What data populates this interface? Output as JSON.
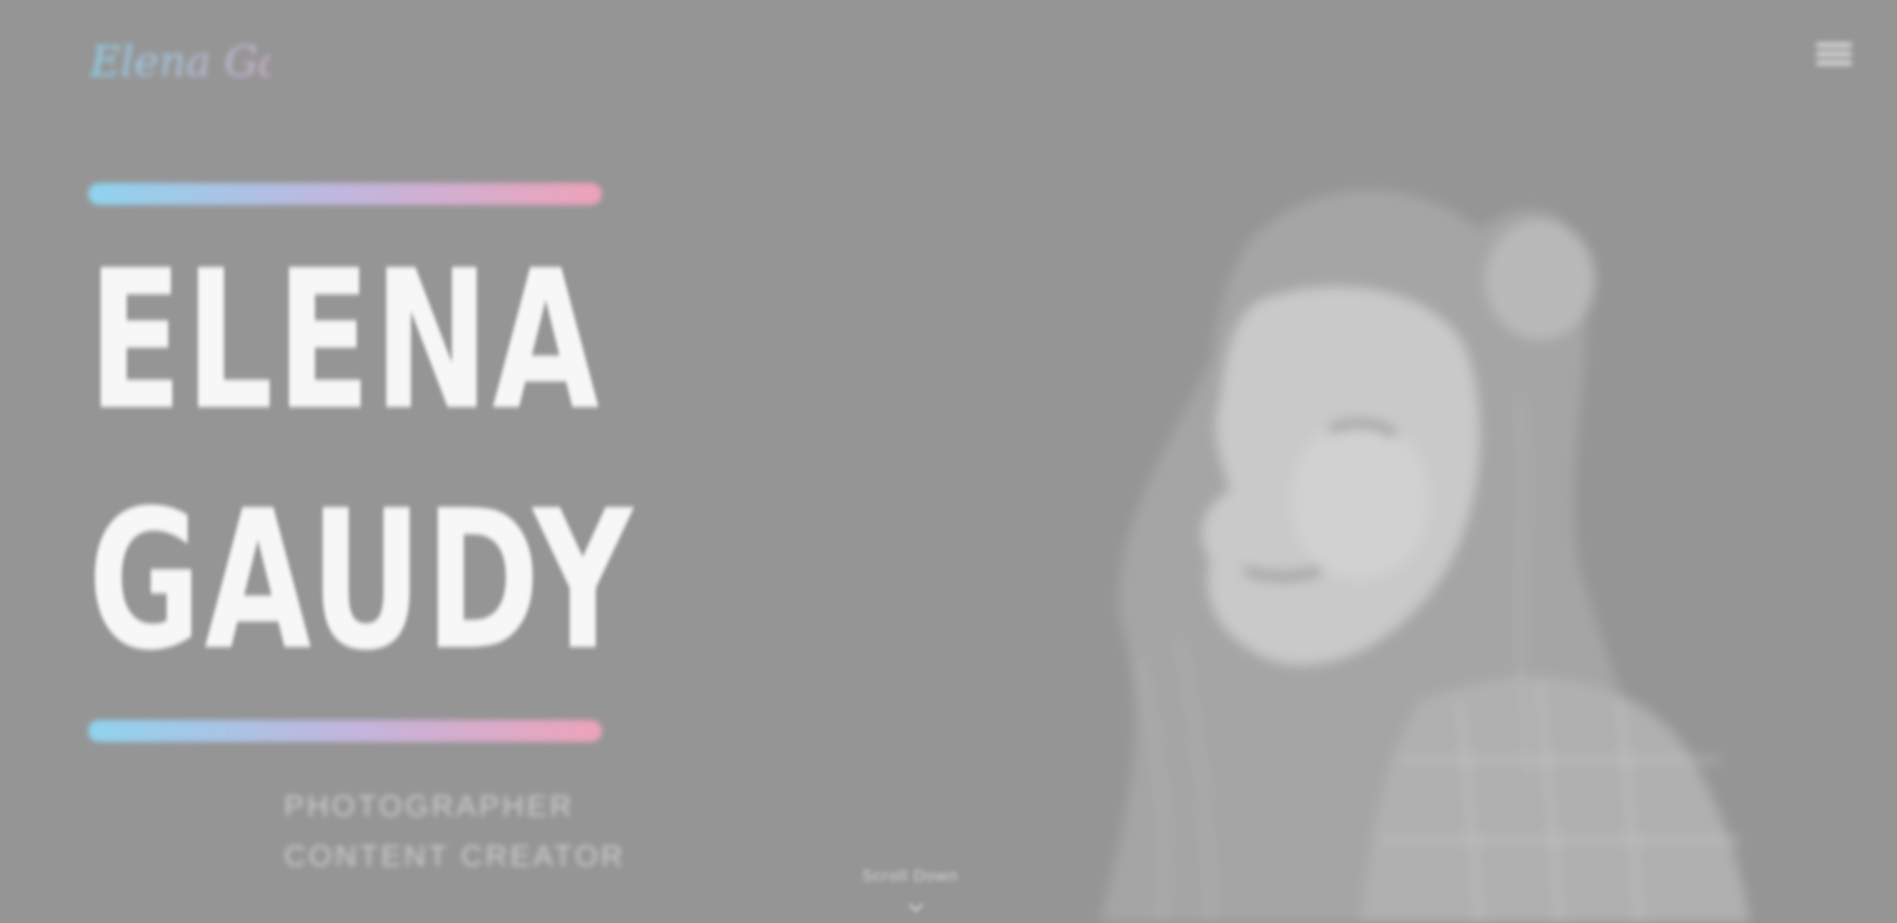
{
  "header": {
    "logo_text": "Elena Gaudy",
    "menu_icon": "hamburger-menu-icon"
  },
  "hero": {
    "name_line1": "ELENA",
    "name_line2": "GAUDY",
    "subtitle_line1": "PHOTOGRAPHER",
    "subtitle_line2": "CONTENT CREATOR",
    "portrait": "portrait-photo"
  },
  "scroll": {
    "label": "Scroll Down",
    "icon": "chevron-down-icon"
  },
  "colors": {
    "background": "#959595",
    "accent_start": "#8fd3ee",
    "accent_mid": "#c1b6de",
    "accent_end": "#eea2b9",
    "name_text": "#f7f7f7"
  }
}
